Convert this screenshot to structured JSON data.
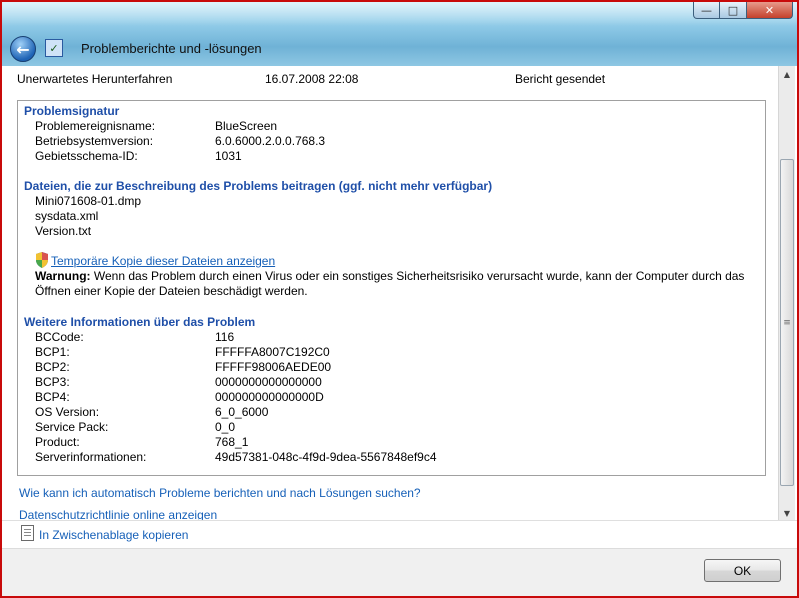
{
  "window": {
    "title": "Problemberichte und -lösungen",
    "controls": {
      "minimize": "—",
      "maximize": "□",
      "close": "✕"
    }
  },
  "summary": {
    "event": "Unerwartetes Herunterfahren",
    "date": "16.07.2008 22:08",
    "status": "Bericht gesendet"
  },
  "signature": {
    "title": "Problemsignatur",
    "rows": [
      {
        "key": "Problemereignisname:",
        "value": "BlueScreen"
      },
      {
        "key": "Betriebsystemversion:",
        "value": "6.0.6000.2.0.0.768.3"
      },
      {
        "key": "Gebietsschema-ID:",
        "value": "1031"
      }
    ]
  },
  "files": {
    "title": "Dateien, die zur Beschreibung des Problems beitragen (ggf. nicht mehr verfügbar)",
    "items": [
      "Mini071608-01.dmp",
      "sysdata.xml",
      "Version.txt"
    ],
    "temp_copy_link": "Temporäre Kopie dieser Dateien anzeigen",
    "warning_label": "Warnung:",
    "warning_text": " Wenn das Problem durch einen Virus oder ein sonstiges Sicherheitsrisiko verursacht wurde, kann der Computer durch das Öffnen einer Kopie der Dateien beschädigt werden."
  },
  "more_info": {
    "title": "Weitere Informationen über das Problem",
    "rows": [
      {
        "key": "BCCode:",
        "value": "116"
      },
      {
        "key": "BCP1:",
        "value": "FFFFFA8007C192C0"
      },
      {
        "key": "BCP2:",
        "value": "FFFFF98006AEDE00"
      },
      {
        "key": "BCP3:",
        "value": "0000000000000000"
      },
      {
        "key": "BCP4:",
        "value": "000000000000000D"
      },
      {
        "key": "OS Version:",
        "value": "6_0_6000"
      },
      {
        "key": "Service Pack:",
        "value": "0_0"
      },
      {
        "key": "Product:",
        "value": "768_1"
      },
      {
        "key": "Serverinformationen:",
        "value": "49d57381-048c-4f9d-9dea-5567848ef9c4"
      }
    ]
  },
  "links": {
    "auto_report": "Wie kann ich automatisch Probleme berichten und nach Lösungen suchen?",
    "privacy": "Datenschutzrichtlinie online anzeigen",
    "copy_clipboard": "In Zwischenablage kopieren"
  },
  "scrollbar": {
    "up": "▲",
    "down": "▼",
    "grip": "≡"
  },
  "buttons": {
    "ok": "OK"
  },
  "icons": {
    "back": "back-arrow-icon",
    "app": "problem-reports-icon",
    "shield": "uac-shield-icon",
    "copy": "clipboard-icon"
  },
  "colors": {
    "link": "#1660b8",
    "section_title": "#1f4fa8",
    "frame": "#c80a0a"
  }
}
